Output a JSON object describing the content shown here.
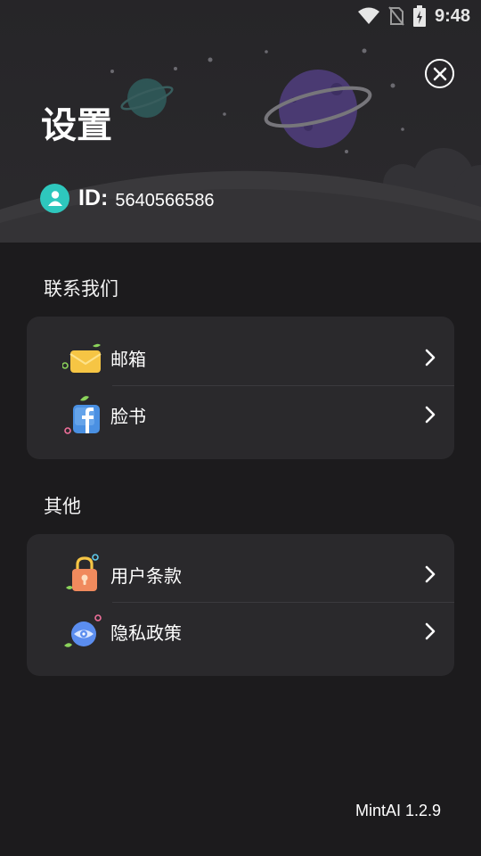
{
  "status_bar": {
    "time": "9:48",
    "icons": [
      "wifi-icon",
      "no-sim-icon",
      "battery-charging-icon"
    ]
  },
  "header": {
    "title": "设置",
    "id_label": "ID:",
    "id_value": "5640566586",
    "close_icon": "close-icon",
    "avatar_icon": "user-avatar-icon"
  },
  "sections": [
    {
      "title": "联系我们",
      "items": [
        {
          "label": "邮箱",
          "icon": "mail-icon"
        },
        {
          "label": "脸书",
          "icon": "facebook-icon"
        }
      ]
    },
    {
      "title": "其他",
      "items": [
        {
          "label": "用户条款",
          "icon": "lock-icon"
        },
        {
          "label": "隐私政策",
          "icon": "eye-icon"
        }
      ]
    }
  ],
  "footer": {
    "version": "MintAI 1.2.9"
  },
  "colors": {
    "background": "#1c1b1d",
    "card": "#2a292c",
    "header": "#2b2a2d",
    "accent_teal": "#2ec7bd",
    "mail_yellow": "#f6c544",
    "facebook_blue": "#4a90e2",
    "lock_orange": "#f08a5d",
    "eye_blue": "#5b8def"
  }
}
